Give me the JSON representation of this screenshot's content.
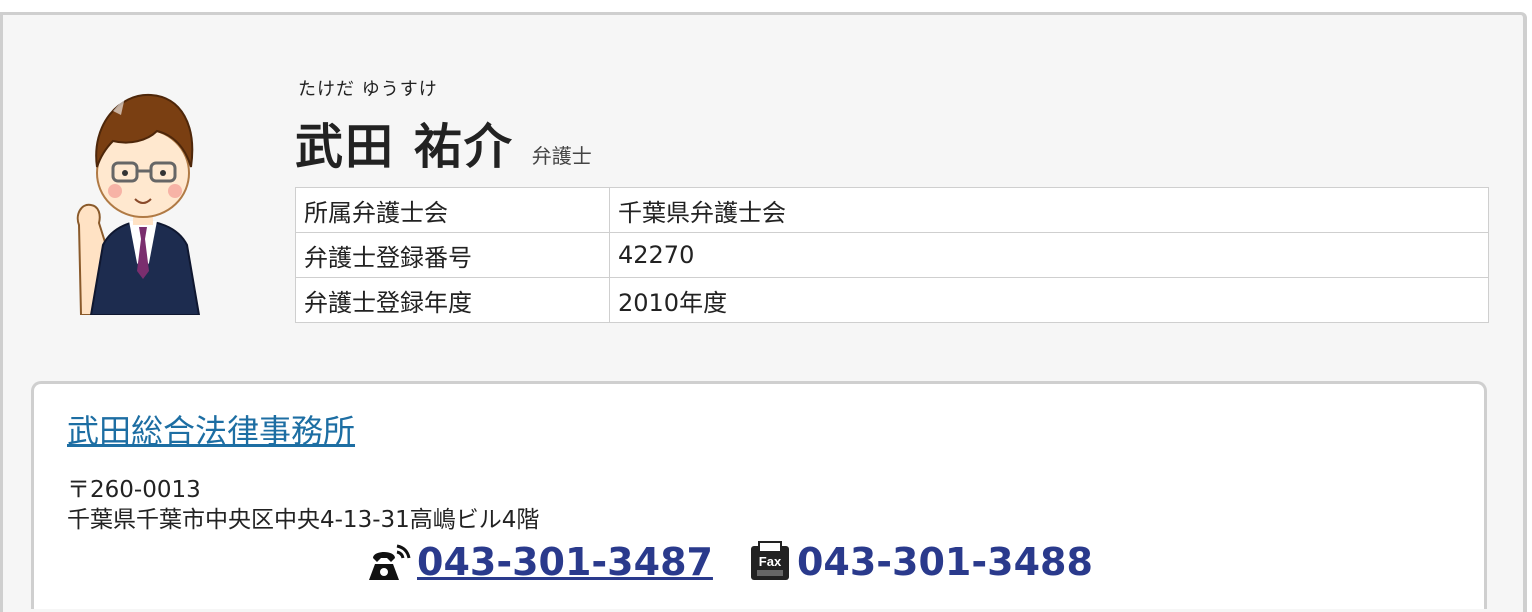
{
  "profile": {
    "ruby": "たけだ ゆうすけ",
    "name": "武田 祐介",
    "title": "弁護士"
  },
  "info_table": {
    "rows": [
      {
        "label": "所属弁護士会",
        "value": "千葉県弁護士会"
      },
      {
        "label": "弁護士登録番号",
        "value": "42270"
      },
      {
        "label": "弁護士登録年度",
        "value": "2010年度"
      }
    ]
  },
  "office": {
    "name": "武田総合法律事務所",
    "postal": "〒260-0013",
    "address": "千葉県千葉市中央区中央4-13-31高嶋ビル4階",
    "phone": "043-301-3487",
    "fax": "043-301-3488",
    "phone_icon": "telephone-icon",
    "fax_icon": "fax-icon",
    "link_color": "#1d6ea3",
    "number_color": "#2a3a8c"
  }
}
